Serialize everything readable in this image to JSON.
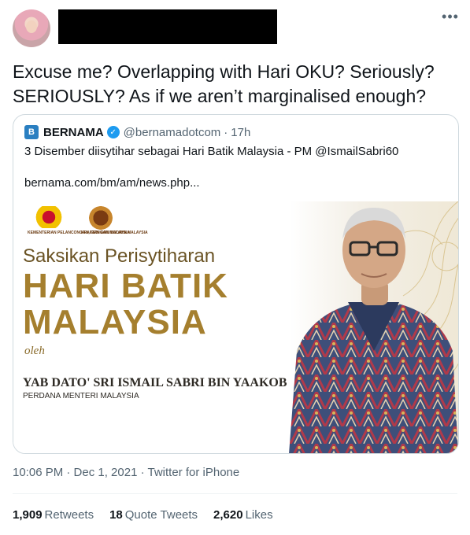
{
  "tweet": {
    "text": "Excuse me? Overlapping with Hari OKU? Seriously? SERIOUSLY? As if we aren’t marginalised enough?",
    "more_icon": "more-horizontal-icon",
    "timestamp": "10:06 PM · Dec 1, 2021",
    "source": "Twitter for iPhone"
  },
  "quoted": {
    "logo_letter": "B",
    "name": "BERNAMA",
    "handle": "@bernamadotcom",
    "separator": "·",
    "time": "17h",
    "text": "3 Disember diisytihar sebagai Hari Batik Malaysia - PM @IsmailSabri60",
    "link": "bernama.com/bm/am/news.php...",
    "image": {
      "caption_a": "KEMENTERIAN PELANCONGAN, SENI DAN BUDAYA MALAYSIA",
      "caption_b": "KRAFTANGAN MALAYSIA",
      "line1": "Saksikan Perisytiharan",
      "line2": "HARI BATIK",
      "line3": "MALAYSIA",
      "line4": "oleh",
      "line5": "YAB DATO' SRI ISMAIL SABRI BIN YAAKOB",
      "line6": "PERDANA MENTERI MALAYSIA"
    }
  },
  "stats": {
    "retweets_count": "1,909",
    "retweets_label": "Retweets",
    "quotes_count": "18",
    "quotes_label": "Quote Tweets",
    "likes_count": "2,620",
    "likes_label": "Likes"
  },
  "colors": {
    "accent": "#1d9bf0",
    "text": "#0f1419",
    "muted": "#536471",
    "border": "#cfd9de",
    "gold": "#a57f2e"
  }
}
